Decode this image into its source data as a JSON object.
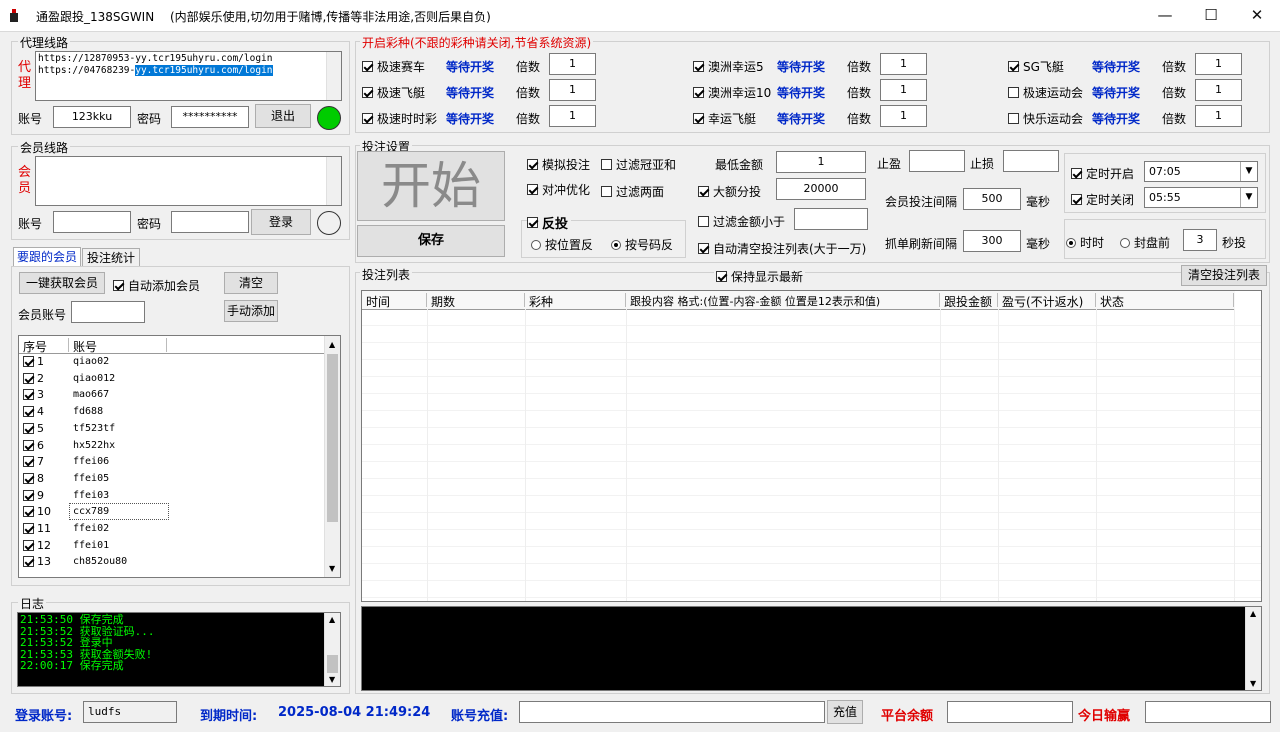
{
  "window": {
    "title": "通盈跟投_138SGWIN",
    "note": "(内部娱乐使用,切勿用于赌博,传播等非法用途,否则后果自负)",
    "minimize": "—",
    "maximize": "☐",
    "close": "✕"
  },
  "proxy": {
    "title": "代理线路",
    "side_label": "代理",
    "lines": [
      "https://12870953-yy.tcr195uhyru.com/login",
      "https://04768239-yy.tcr195uhyru.com/login"
    ],
    "account_label": "账号",
    "account_value": "123kku",
    "password_label": "密码",
    "password_value": "**********",
    "logout_label": "退出",
    "status_color": "#00cc00"
  },
  "member": {
    "title": "会员线路",
    "side_label": "会员",
    "account_label": "账号",
    "account_value": "",
    "password_label": "密码",
    "password_value": "",
    "login_label": "登录"
  },
  "tabs": [
    {
      "label": "要跟的会员",
      "active": true
    },
    {
      "label": "投注统计",
      "active": false
    }
  ],
  "members_panel": {
    "fetch_label": "一键获取会员",
    "auto_add_label": "自动添加会员",
    "auto_add_checked": true,
    "clear_label": "清空",
    "account_label": "会员账号",
    "manual_add_label": "手动添加",
    "col_index": "序号",
    "col_account": "账号",
    "rows": [
      {
        "idx": "1",
        "acct": "qiao02"
      },
      {
        "idx": "2",
        "acct": "qiao012"
      },
      {
        "idx": "3",
        "acct": "mao667"
      },
      {
        "idx": "4",
        "acct": "fd688"
      },
      {
        "idx": "5",
        "acct": "tf523tf"
      },
      {
        "idx": "6",
        "acct": "hx522hx"
      },
      {
        "idx": "7",
        "acct": "ffei06"
      },
      {
        "idx": "8",
        "acct": "ffei05"
      },
      {
        "idx": "9",
        "acct": "ffei03"
      },
      {
        "idx": "10",
        "acct": "ccx789"
      },
      {
        "idx": "11",
        "acct": "ffei02"
      },
      {
        "idx": "12",
        "acct": "ffei01"
      },
      {
        "idx": "13",
        "acct": "ch852ou80"
      }
    ]
  },
  "log": {
    "title": "日志",
    "lines": [
      "21:53:50  保存完成",
      "21:53:52  获取验证码...",
      "21:53:52  登录中",
      "21:53:53  获取金额失败!",
      "22:00:17  保存完成"
    ]
  },
  "lottery": {
    "title": "开启彩种(不跟的彩种请关闭,节省系统资源)",
    "multiplier_label": "倍数",
    "items": [
      {
        "name": "极速赛车",
        "checked": true,
        "status": "等待开奖",
        "mult": "1"
      },
      {
        "name": "极速飞艇",
        "checked": true,
        "status": "等待开奖",
        "mult": "1"
      },
      {
        "name": "极速时时彩",
        "checked": true,
        "status": "等待开奖",
        "mult": "1"
      },
      {
        "name": "澳洲幸运5",
        "checked": true,
        "status": "等待开奖",
        "mult": "1"
      },
      {
        "name": "澳洲幸运10",
        "checked": true,
        "status": "等待开奖",
        "mult": "1"
      },
      {
        "name": "幸运飞艇",
        "checked": true,
        "status": "等待开奖",
        "mult": "1"
      },
      {
        "name": "SG飞艇",
        "checked": true,
        "status": "等待开奖",
        "mult": "1"
      },
      {
        "name": "极速运动会",
        "checked": false,
        "status": "等待开奖",
        "mult": "1"
      },
      {
        "name": "快乐运动会",
        "checked": false,
        "status": "等待开奖",
        "mult": "1"
      }
    ]
  },
  "bet": {
    "title": "投注设置",
    "start_label": "开始",
    "save_label": "保存",
    "simulate_label": "模拟投注",
    "filter_champion_label": "过滤冠亚和",
    "hedge_label": "对冲优化",
    "filter_both_label": "过滤两面",
    "reverse_label": "反投",
    "reverse_by_pos": "按位置反",
    "reverse_by_num": "按号码反",
    "min_amount_label": "最低金额",
    "min_amount_value": "1",
    "big_split_label": "大额分投",
    "big_split_value": "20000",
    "filter_below_label": "过滤金额小于",
    "filter_below_value": "",
    "auto_clear_label": "自动清空投注列表(大于一万)",
    "take_profit_label": "止盈",
    "take_profit_value": "",
    "stop_loss_label": "止损",
    "stop_loss_value": "",
    "interval_label": "会员投注间隔",
    "interval_value": "500",
    "refresh_label": "抓单刷新间隔",
    "refresh_value": "300",
    "ms_label": "毫秒",
    "timer_on_label": "定时开启",
    "timer_on_value": "07:05",
    "timer_off_label": "定时关闭",
    "timer_off_value": "05:55",
    "realtime_label": "时时",
    "before_close_label": "封盘前",
    "before_close_value": "3",
    "seconds_label": "秒投"
  },
  "bet_list": {
    "title": "投注列表",
    "keep_latest_label": "保持显示最新",
    "clear_label": "清空投注列表",
    "columns": [
      "时间",
      "期数",
      "彩种",
      "跟投内容 格式:(位置-内容-金额  位置是12表示和值)",
      "跟投金额",
      "盈亏(不计返水)",
      "状态"
    ]
  },
  "status_bar": {
    "login_account_label": "登录账号:",
    "login_account_value": "ludfs",
    "expire_label": "到期时间:",
    "expire_value": "2025-08-04 21:49:24",
    "recharge_label": "账号充值:",
    "recharge_value": "",
    "recharge_button": "充值",
    "balance_label": "平台余额",
    "balance_value": "",
    "today_label": "今日输赢",
    "today_value": ""
  },
  "colors": {
    "accent_red": "#e00000",
    "status_blue": "#0028c8",
    "log_green": "#00ff00"
  }
}
